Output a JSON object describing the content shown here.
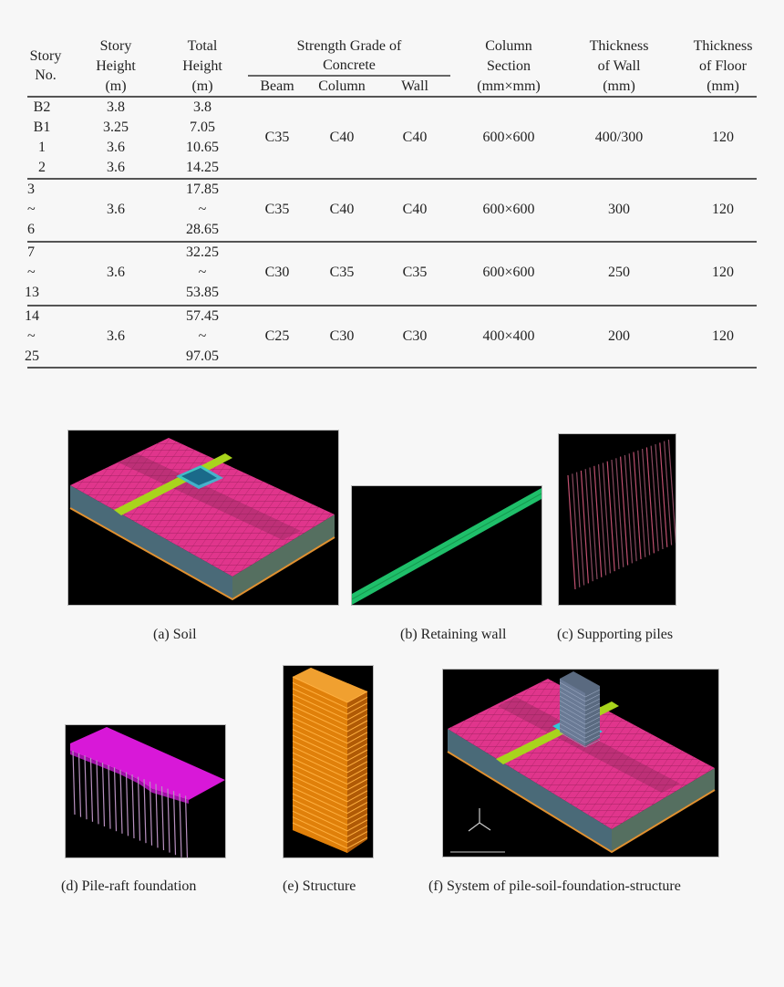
{
  "table": {
    "headers": {
      "story_no": [
        "Story",
        "No."
      ],
      "story_height": [
        "Story",
        "Height",
        "(m)"
      ],
      "total_height": [
        "Total",
        "Height",
        "(m)"
      ],
      "strength_grade": [
        "Strength Grade of",
        "Concrete"
      ],
      "beam": "Beam",
      "column": "Column",
      "wall": "Wall",
      "column_section": [
        "Column",
        "Section",
        "(mm×mm)"
      ],
      "wall_thickness": [
        "Thickness",
        "of Wall",
        "(mm)"
      ],
      "floor_thickness": [
        "Thickness",
        "of Floor",
        "(mm)"
      ]
    },
    "groups": [
      {
        "story_no": [
          "B2",
          "B1",
          "1",
          "2"
        ],
        "story_height": [
          "3.8",
          "3.25",
          "3.6",
          "3.6"
        ],
        "total_height": [
          "3.8",
          "7.05",
          "10.65",
          "14.25"
        ],
        "beam": "C35",
        "column": "C40",
        "wall": "C40",
        "column_section": "600×600",
        "wall_thickness": "400/300",
        "floor_thickness": "120"
      },
      {
        "story_no": [
          "3",
          "~",
          "6"
        ],
        "story_height": [
          "3.6"
        ],
        "total_height": [
          "17.85",
          "~",
          "28.65"
        ],
        "beam": "C35",
        "column": "C40",
        "wall": "C40",
        "column_section": "600×600",
        "wall_thickness": "300",
        "floor_thickness": "120"
      },
      {
        "story_no": [
          "7",
          "~",
          "13"
        ],
        "story_height": [
          "3.6"
        ],
        "total_height": [
          "32.25",
          "~",
          "53.85"
        ],
        "beam": "C30",
        "column": "C35",
        "wall": "C35",
        "column_section": "600×600",
        "wall_thickness": "250",
        "floor_thickness": "120"
      },
      {
        "story_no": [
          "14",
          "~",
          "25"
        ],
        "story_height": [
          "3.6"
        ],
        "total_height": [
          "57.45",
          "~",
          "97.05"
        ],
        "beam": "C25",
        "column": "C30",
        "wall": "C30",
        "column_section": "400×400",
        "wall_thickness": "200",
        "floor_thickness": "120"
      }
    ]
  },
  "figures": [
    {
      "id": "a",
      "caption": "(a) Soil",
      "image": "soil-mesh"
    },
    {
      "id": "b",
      "caption": "(b) Retaining wall",
      "image": "retaining-wall"
    },
    {
      "id": "c",
      "caption": "(c) Supporting piles",
      "image": "supporting-piles"
    },
    {
      "id": "d",
      "caption": "(d) Pile-raft foundation",
      "image": "pile-raft-foundation"
    },
    {
      "id": "e",
      "caption": "(e) Structure",
      "image": "building-structure"
    },
    {
      "id": "f",
      "caption": "(f) System of pile-soil-foundation-structure",
      "image": "full-system"
    }
  ],
  "colors": {
    "soil": "#e0358c",
    "retaining_wall_green": "#1fbf6a",
    "strip_yellow_green": "#a8d41c",
    "pile_pink": "#b04a6a",
    "raft_magenta": "#d818d8",
    "structure_orange": "#e0800a",
    "excavation_cyan": "#2ec8d8"
  }
}
